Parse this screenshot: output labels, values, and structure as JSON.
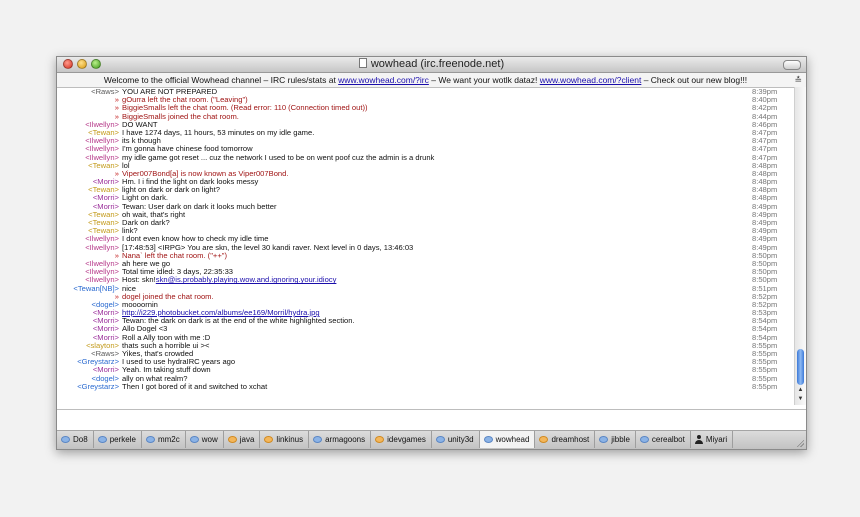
{
  "window": {
    "title": "wowhead (irc.freenode.net)"
  },
  "topic": {
    "t1": "Welcome to the official Wowhead channel – IRC rules/stats at ",
    "l1": "www.wowhead.com/?irc",
    "t2": " – We want your wotlk dataz! ",
    "l2": "www.wowhead.com/?client",
    "t3": " – Check out our new blog!!!"
  },
  "colors": {
    "nick_default": "#333333",
    "event": "#c21b1b",
    "link": "#1a0dab",
    "scroll_thumb": "#3b78d8"
  },
  "messages": [
    {
      "nick": "<Raws>",
      "text": "YOU ARE NOT PREPARED",
      "time": "8:39pm",
      "nc": "#5a5a5a"
    },
    {
      "nick": "»",
      "text": "gOurra left the chat room. (\"Leaving\")",
      "time": "8:40pm",
      "event": true
    },
    {
      "nick": "»",
      "text": "BiggieSmalls left the chat room. (Read error: 110 (Connection timed out))",
      "time": "8:42pm",
      "event": true
    },
    {
      "nick": "»",
      "text": "BiggieSmalls joined the chat room.",
      "time": "8:44pm",
      "event": true
    },
    {
      "nick": "<Ilwellyn>",
      "text": "DO WANT",
      "time": "8:46pm",
      "nc": "#b63a8a"
    },
    {
      "nick": "<Tewan>",
      "text": "I have 1274 days, 11 hours, 53 minutes on my idle game.",
      "time": "8:47pm",
      "nc": "#c39a1a"
    },
    {
      "nick": "<Ilwellyn>",
      "text": "its k though",
      "time": "8:47pm",
      "nc": "#b63a8a"
    },
    {
      "nick": "<Ilwellyn>",
      "text": "I'm gonna have chinese food tomorrow",
      "time": "8:47pm",
      "nc": "#b63a8a"
    },
    {
      "nick": "<Ilwellyn>",
      "text": "my idle game got reset ... cuz the network I used to be on went poof cuz the admin is a drunk",
      "time": "8:47pm",
      "nc": "#b63a8a"
    },
    {
      "nick": "<Tewan>",
      "text": "lol",
      "time": "8:48pm",
      "nc": "#c39a1a"
    },
    {
      "nick": "»",
      "text": "Viper007Bond[a] is now known as Viper007Bond.",
      "time": "8:48pm",
      "event": true
    },
    {
      "nick": "<Morri>",
      "text": "Hm. I i find the light on dark looks messy",
      "time": "8:48pm",
      "nc": "#9b2f9b"
    },
    {
      "nick": "<Tewan>",
      "text": "light on dark or dark on light?",
      "time": "8:48pm",
      "nc": "#c39a1a"
    },
    {
      "nick": "<Morri>",
      "text": "Light on dark.",
      "time": "8:48pm",
      "nc": "#9b2f9b"
    },
    {
      "nick": "<Morri>",
      "text": "Tewan: User dark on dark it looks much better",
      "time": "8:49pm",
      "nc": "#9b2f9b"
    },
    {
      "nick": "<Tewan>",
      "text": "oh wait, that's right",
      "time": "8:49pm",
      "nc": "#c39a1a"
    },
    {
      "nick": "<Tewan>",
      "text": "Dark on dark?",
      "time": "8:49pm",
      "nc": "#c39a1a"
    },
    {
      "nick": "<Tewan>",
      "text": "link?",
      "time": "8:49pm",
      "nc": "#c39a1a"
    },
    {
      "nick": "<Ilwellyn>",
      "text": "I dont even know how to check my idle time",
      "time": "8:49pm",
      "nc": "#b63a8a"
    },
    {
      "nick": "<Ilwellyn>",
      "text": "[17:48:53] <IRPG> You are skn, the level 30 kandi raver. Next level in 0 days, 13:46:03",
      "time": "8:49pm",
      "nc": "#b63a8a"
    },
    {
      "nick": "»",
      "text": "Nana` left the chat room. (\"++\")",
      "time": "8:50pm",
      "event": true
    },
    {
      "nick": "<Ilwellyn>",
      "text": "ah here we go",
      "time": "8:50pm",
      "nc": "#b63a8a"
    },
    {
      "nick": "<Ilwellyn>",
      "text": "Total time idled: 3 days, 22:35:33",
      "time": "8:50pm",
      "nc": "#b63a8a"
    },
    {
      "nick": "<Ilwellyn>",
      "text": "Host: skn!",
      "link": "skn@is.probably.playing.wow.and.ignoring.your.idiocy",
      "time": "8:50pm",
      "nc": "#b63a8a"
    },
    {
      "nick": "<Tewan[NB]>",
      "text": "nice",
      "time": "8:51pm",
      "nc": "#2a6ad0"
    },
    {
      "nick": "»",
      "text": "dogel joined the chat room.",
      "time": "8:52pm",
      "event": true
    },
    {
      "nick": "<dogel>",
      "text": "moooornin",
      "time": "8:52pm",
      "nc": "#2a6ad0"
    },
    {
      "nick": "<Morri>",
      "text": "",
      "link": "http://i229.photobucket.com/albums/ee169/Morril/hydra.jpg",
      "time": "8:53pm",
      "nc": "#9b2f9b"
    },
    {
      "nick": "<Morri>",
      "text": "Tewan: the dark on dark is at the end of the white highlighted section.",
      "time": "8:54pm",
      "nc": "#9b2f9b"
    },
    {
      "nick": "<Morri>",
      "text": "Allo Dogel <3",
      "time": "8:54pm",
      "nc": "#9b2f9b"
    },
    {
      "nick": "<Morri>",
      "text": "Roll a Ally toon with me :D",
      "time": "8:54pm",
      "nc": "#9b2f9b"
    },
    {
      "nick": "<slayton>",
      "text": "thats such a horrible ui ><",
      "time": "8:55pm",
      "nc": "#c39a1a"
    },
    {
      "nick": "<Raws>",
      "text": "Yikes, that's crowded",
      "time": "8:55pm",
      "nc": "#5a5a5a"
    },
    {
      "nick": "<Greystarz>",
      "text": "I used to use hydraIRC years ago",
      "time": "8:55pm",
      "nc": "#2a6ad0"
    },
    {
      "nick": "<Morri>",
      "text": "Yeah. Im taking stuff down",
      "time": "8:55pm",
      "nc": "#9b2f9b"
    },
    {
      "nick": "<dogel>",
      "text": "ally on what realm?",
      "time": "8:55pm",
      "nc": "#2a6ad0"
    },
    {
      "nick": "<Greystarz>",
      "text": "Then I got bored of it and switched to xchat",
      "time": "8:55pm",
      "nc": "#2a6ad0"
    }
  ],
  "input": {
    "value": ""
  },
  "tabs": [
    {
      "label": "Do8",
      "icon": "blue"
    },
    {
      "label": "perkele",
      "icon": "blue"
    },
    {
      "label": "mm2c",
      "icon": "blue"
    },
    {
      "label": "wow",
      "icon": "blue"
    },
    {
      "label": "java",
      "icon": "orange"
    },
    {
      "label": "linkinus",
      "icon": "orange"
    },
    {
      "label": "armagoons",
      "icon": "blue"
    },
    {
      "label": "idevgames",
      "icon": "orange"
    },
    {
      "label": "unity3d",
      "icon": "blue"
    },
    {
      "label": "wowhead",
      "icon": "blue",
      "active": true
    },
    {
      "label": "dreamhost",
      "icon": "orange"
    },
    {
      "label": "jibble",
      "icon": "blue"
    },
    {
      "label": "cerealbot",
      "icon": "blue"
    },
    {
      "label": "Miyari",
      "icon": "person"
    }
  ]
}
